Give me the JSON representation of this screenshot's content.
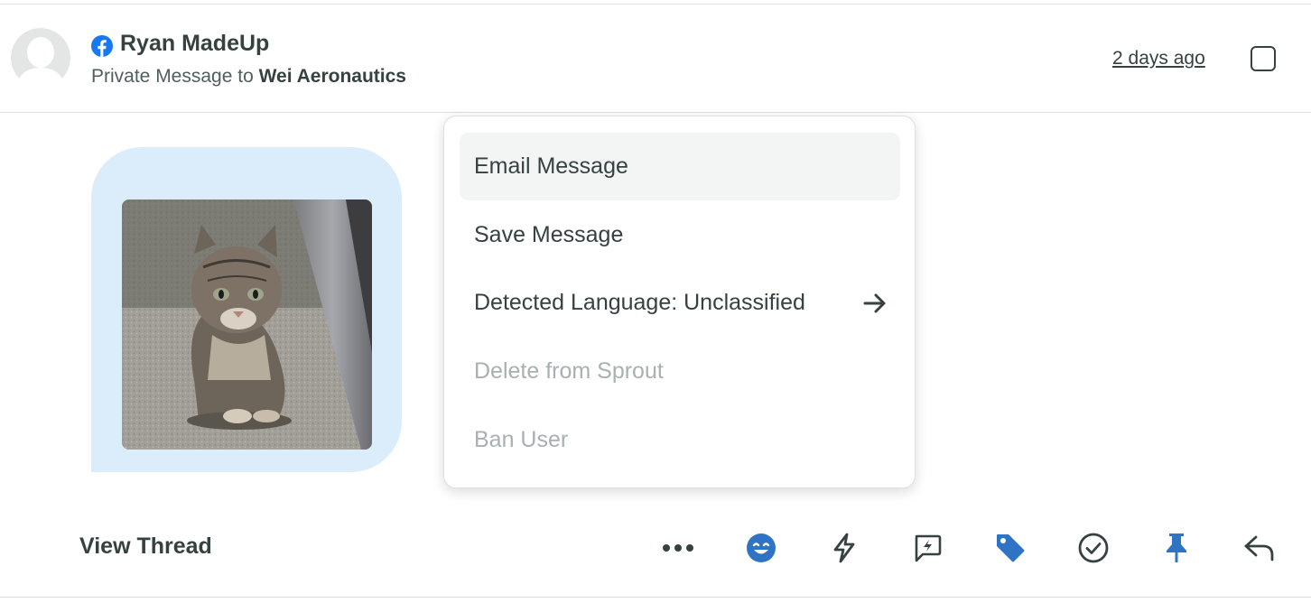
{
  "message": {
    "author": "Ryan MadeUp",
    "network_icon": "facebook-icon",
    "sub_prefix": "Private Message to",
    "recipient": "Wei Aeronautics",
    "timestamp": "2 days ago"
  },
  "menu": {
    "items": [
      {
        "label": "Email Message",
        "state": "highlighted"
      },
      {
        "label": "Save Message",
        "state": "enabled"
      },
      {
        "label": "Detected Language: Unclassified",
        "state": "enabled",
        "icon": "arrow-right-icon"
      },
      {
        "label": "Delete from Sprout",
        "state": "disabled"
      },
      {
        "label": "Ban User",
        "state": "disabled"
      }
    ]
  },
  "footer": {
    "view_thread": "View Thread",
    "actions": [
      "more-icon",
      "sentiment-icon",
      "quick-action-icon",
      "bot-message-icon",
      "tag-icon",
      "complete-icon",
      "pin-icon",
      "reply-icon"
    ]
  },
  "colors": {
    "text": "#364141",
    "accent_blue": "#2f73c4",
    "bubble": "#dbedfb",
    "facebook": "#1877f2",
    "disabled": "#a9b0b0"
  }
}
